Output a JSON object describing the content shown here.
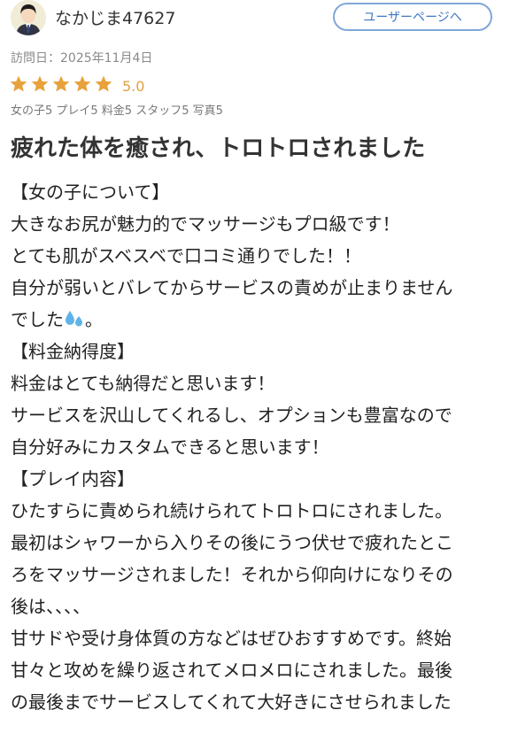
{
  "header": {
    "username": "なかじま47627",
    "user_page_button": "ユーザーページへ"
  },
  "visit_date": "訪問日：2025年11月4日",
  "rating": {
    "stars": 5,
    "max_stars": 5,
    "score": "5.0",
    "subscores": "女の子5 プレイ5 料金5 スタッフ5 写真5",
    "star_color": "#e8a23c"
  },
  "review": {
    "title": "疲れた体を癒され、トロトロされました",
    "lines": [
      "【女の子について】",
      "大きなお尻が魅力的でマッサージもプロ級です！",
      "とても肌がスベスベで口コミ通りでした！！",
      "自分が弱いとバレてからサービスの責めが止まりません",
      "でした",
      "【料金納得度】",
      "料金はとても納得だと思います！",
      "サービスを沢山してくれるし、オプションも豊富なので",
      "自分好みにカスタムできると思います！",
      "【プレイ内容】",
      "ひたすらに責められ続けられてトロトロにされました。",
      "最初はシャワーから入りその後にうつ伏せで疲れたとこ",
      "ろをマッサージされました！それから仰向けになりその",
      "後は、、、、",
      "甘サドや受け身体質の方などはぜひおすすめです。終始",
      "甘々と攻めを繰り返されてメロメロにされました。最後",
      "の最後までサービスしてくれて大好きにさせられました"
    ],
    "line4_suffix": "。"
  }
}
